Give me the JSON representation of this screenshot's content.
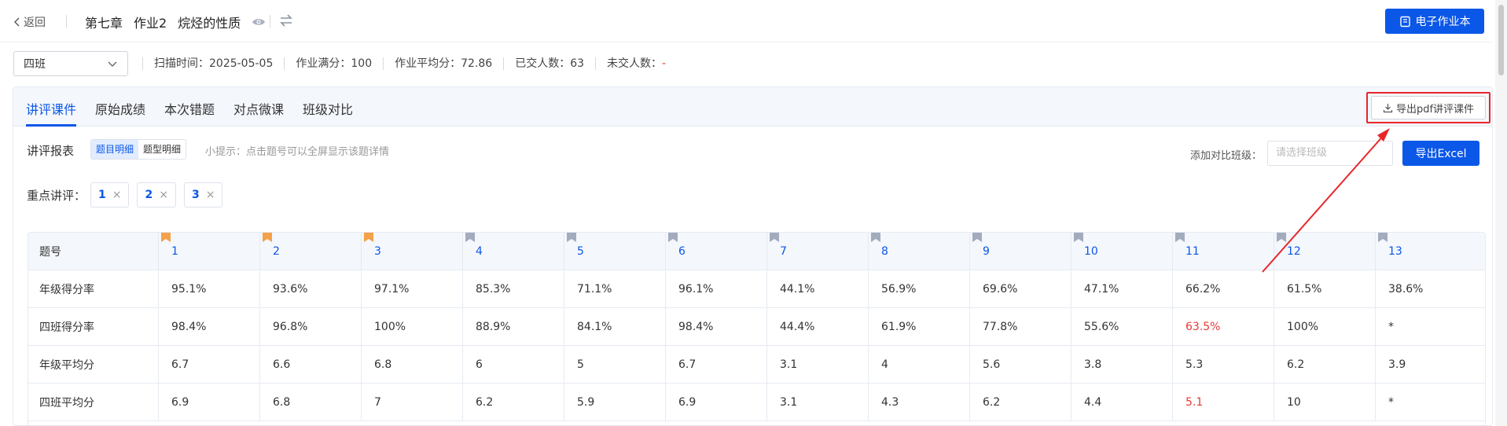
{
  "header": {
    "back_label": "返回",
    "chapter": "第七章",
    "assignment": "作业2",
    "topic": "烷烃的性质",
    "ebook_button": "电子作业本"
  },
  "info": {
    "class_selected": "四班",
    "scan_time": "扫描时间：2025-05-05",
    "full_score": "作业满分：100",
    "avg_score": "作业平均分：72.86",
    "submitted": "已交人数：63",
    "not_submitted_label": "未交人数：",
    "not_submitted_value": "-"
  },
  "tabs": [
    "讲评课件",
    "原始成绩",
    "本次错题",
    "对点微课",
    "班级对比"
  ],
  "export_pdf_label": "导出pdf讲评课件",
  "report": {
    "label": "讲评报表",
    "seg_options": [
      "题目明细",
      "题型明细"
    ],
    "tip": "小提示：点击题号可以全屏显示该题详情",
    "compare_label": "添加对比班级：",
    "compare_placeholder": "请选择班级",
    "export_excel": "导出Excel"
  },
  "focus": {
    "label": "重点讲评：",
    "tags": [
      "1",
      "2",
      "3"
    ],
    "close_glyph": "×"
  },
  "table": {
    "header_label": "题号",
    "questions": [
      "1",
      "2",
      "3",
      "4",
      "5",
      "6",
      "7",
      "8",
      "9",
      "10",
      "11",
      "12",
      "13"
    ],
    "flag_colors": {
      "marked": "#f4a14a",
      "normal": "#a3acbd"
    },
    "rows": [
      {
        "label": "年级得分率",
        "values": [
          "95.1%",
          "93.6%",
          "97.1%",
          "85.3%",
          "71.1%",
          "96.1%",
          "44.1%",
          "56.9%",
          "69.6%",
          "47.1%",
          "66.2%",
          "61.5%",
          "38.6%"
        ]
      },
      {
        "label": "四班得分率",
        "values": [
          "98.4%",
          "96.8%",
          "100%",
          "88.9%",
          "84.1%",
          "98.4%",
          "44.4%",
          "61.9%",
          "77.8%",
          "55.6%",
          "63.5%",
          "100%",
          "*"
        ]
      },
      {
        "label": "年级平均分",
        "values": [
          "6.7",
          "6.6",
          "6.8",
          "6",
          "5",
          "6.7",
          "3.1",
          "4",
          "5.6",
          "3.8",
          "5.3",
          "6.2",
          "3.9"
        ]
      },
      {
        "label": "四班平均分",
        "values": [
          "6.9",
          "6.8",
          "7",
          "6.2",
          "5.9",
          "6.9",
          "3.1",
          "4.3",
          "6.2",
          "4.4",
          "5.1",
          "10",
          "*"
        ]
      }
    ]
  }
}
